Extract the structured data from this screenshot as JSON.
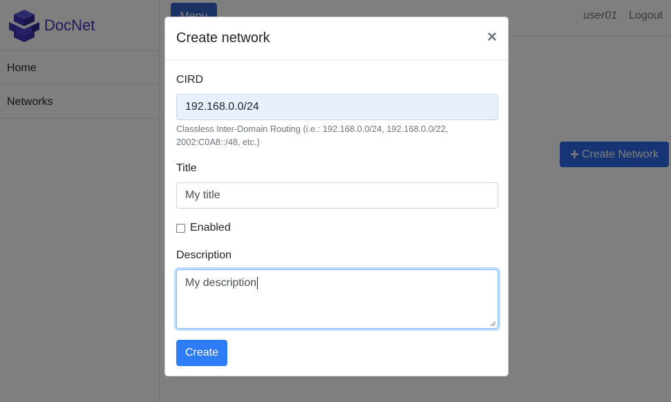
{
  "brand": {
    "name": "DocNet",
    "logo_icon": "cube-stack-logo"
  },
  "sidebar": {
    "items": [
      {
        "label": "Home"
      },
      {
        "label": "Networks"
      }
    ]
  },
  "topbar": {
    "menu_label": "Menu",
    "user": "user01",
    "logout_label": "Logout"
  },
  "page": {
    "create_network_label": "Create Network",
    "create_network_icon": "plus-icon"
  },
  "modal": {
    "title": "Create network",
    "close_icon": "close-icon",
    "cird": {
      "label": "CIRD",
      "value": "192.168.0.0/24",
      "help": "Classless Inter-Domain Routing (i.e.: 192.168.0.0/24, 192.168.0.0/22, 2002:C0A8::/48, etc.)"
    },
    "title_field": {
      "label": "Title",
      "value": "My title"
    },
    "enabled": {
      "label": "Enabled",
      "checked": false
    },
    "description": {
      "label": "Description",
      "value": "My description"
    },
    "submit_label": "Create"
  },
  "colors": {
    "brand": "#3f36b5",
    "primary": "#2f7df6",
    "autofill": "#e8f0fe"
  }
}
